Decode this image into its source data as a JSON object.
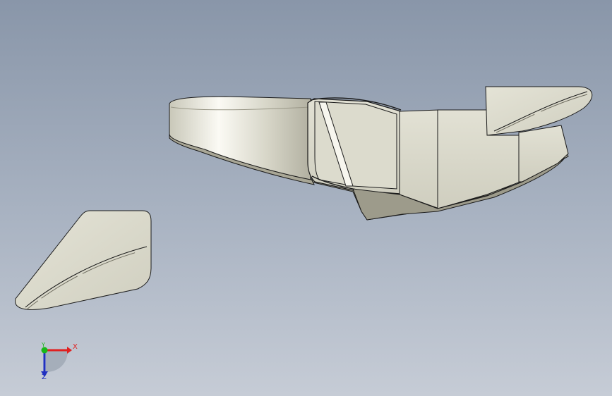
{
  "viewport": {
    "background_top": "#8996a9",
    "background_bottom": "#c6ccd6"
  },
  "model": {
    "body_color": "#e3e2d6",
    "shade_color": "#8e8c7c",
    "edge_color": "#1a1a1a"
  },
  "triad": {
    "x_label": "X",
    "y_label": "Y",
    "z_label": "Z",
    "x_color": "#e02020",
    "y_color": "#18b818",
    "z_color": "#2030c0"
  }
}
